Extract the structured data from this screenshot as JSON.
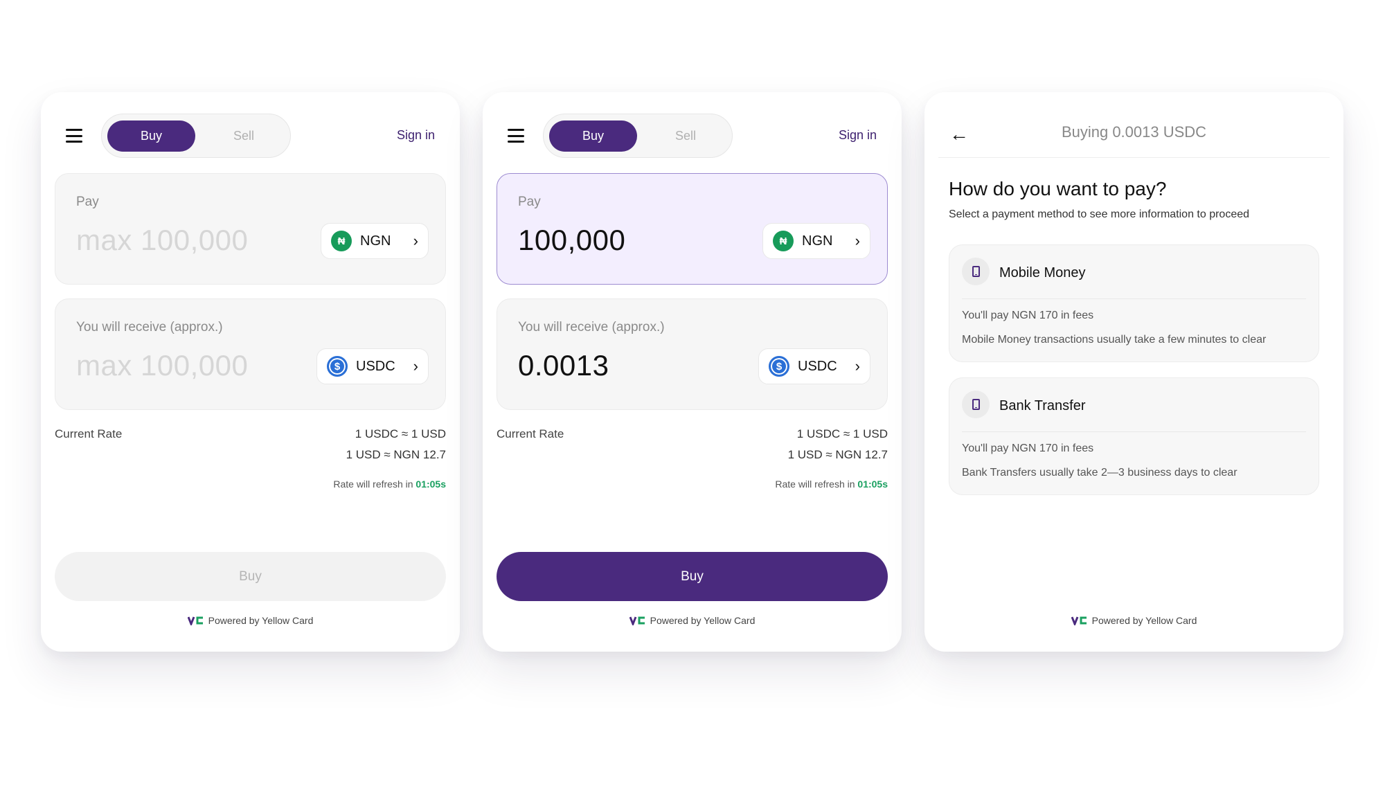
{
  "colors": {
    "primary": "#4a2a7e",
    "timer": "#1aa060",
    "ngn_icon": "#179b5a",
    "usdc_icon": "#2a6fd6"
  },
  "panels": [
    {
      "toggle": {
        "buy": "Buy",
        "sell": "Sell"
      },
      "sign_in": "Sign in",
      "pay": {
        "label": "Pay",
        "value": "max 100,000",
        "currency": "NGN"
      },
      "receive": {
        "label": "You will receive (approx.)",
        "value": "max 100,000",
        "currency": "USDC"
      },
      "rate": {
        "label": "Current Rate",
        "line1": "1 USDC ≈ 1 USD",
        "line2": "1 USD ≈ NGN 12.7",
        "refresh_text": "Rate will refresh in ",
        "timer": "01:05s"
      },
      "buy_button": "Buy",
      "footer": "Powered by Yellow Card"
    },
    {
      "toggle": {
        "buy": "Buy",
        "sell": "Sell"
      },
      "sign_in": "Sign in",
      "pay": {
        "label": "Pay",
        "value": "100,000",
        "currency": "NGN"
      },
      "receive": {
        "label": "You will receive (approx.)",
        "value": "0.0013",
        "currency": "USDC"
      },
      "rate": {
        "label": "Current Rate",
        "line1": "1 USDC ≈ 1 USD",
        "line2": "1 USD ≈ NGN 12.7",
        "refresh_text": "Rate will refresh in ",
        "timer": "01:05s"
      },
      "buy_button": "Buy",
      "footer": "Powered by Yellow Card"
    }
  ],
  "payment": {
    "title": "Buying 0.0013 USDC",
    "heading": "How do you want to pay?",
    "subheading": "Select a payment method to see more information to proceed",
    "methods": [
      {
        "name": "Mobile Money",
        "fee": "You'll pay NGN 170 in fees",
        "time": "Mobile Money transactions usually take a few minutes to clear",
        "icon": "phone-icon"
      },
      {
        "name": "Bank Transfer",
        "fee": "You'll pay NGN 170 in fees",
        "time": "Bank Transfers usually take 2—3 business days to clear",
        "icon": "phone-icon"
      }
    ],
    "footer": "Powered by Yellow Card"
  }
}
